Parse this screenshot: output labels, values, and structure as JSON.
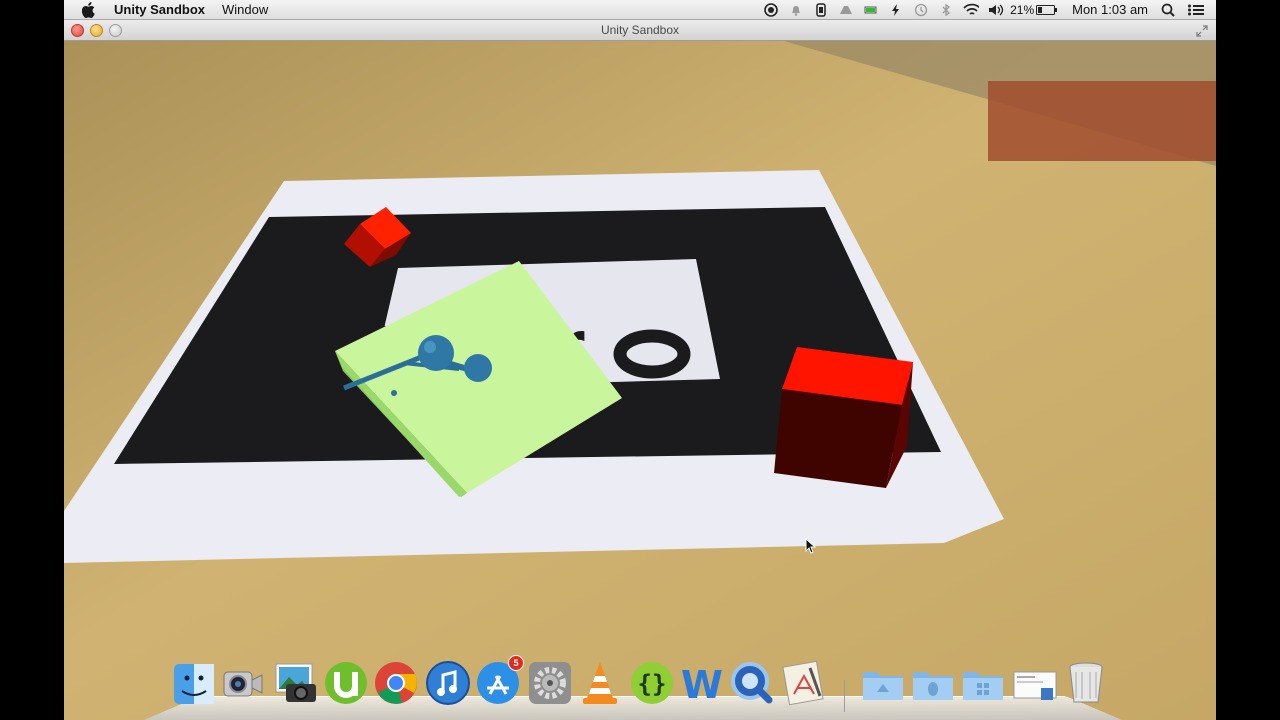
{
  "menubar": {
    "apple_icon": "apple-icon",
    "app_name": "Unity Sandbox",
    "menus": [
      "Window"
    ],
    "status": {
      "battery_percent": "21%",
      "clock": "Mon 1:03 am",
      "icons": [
        "record-icon",
        "notification-bell-icon",
        "phone-icon",
        "drive-icon",
        "battery-green-icon",
        "power-icon",
        "time-machine-icon",
        "bluetooth-icon",
        "wifi-icon",
        "volume-icon",
        "battery-icon",
        "spotlight-icon",
        "notification-center-icon"
      ]
    }
  },
  "window": {
    "title": "Unity Sandbox"
  },
  "dock": {
    "items": [
      {
        "name": "finder",
        "icon": "finder-icon"
      },
      {
        "name": "facetime",
        "icon": "facetime-camera-icon"
      },
      {
        "name": "iphoto",
        "icon": "photo-camera-icon"
      },
      {
        "name": "utorrent",
        "icon": "utorrent-icon"
      },
      {
        "name": "chrome",
        "icon": "chrome-icon"
      },
      {
        "name": "itunes",
        "icon": "itunes-icon"
      },
      {
        "name": "app-store",
        "icon": "app-store-icon",
        "badge": "5"
      },
      {
        "name": "system-preferences",
        "icon": "gear-icon"
      },
      {
        "name": "vlc",
        "icon": "vlc-cone-icon"
      },
      {
        "name": "script-editor",
        "icon": "braces-icon"
      },
      {
        "name": "word",
        "icon": "word-w-icon"
      },
      {
        "name": "quicktime",
        "icon": "quicktime-icon"
      },
      {
        "name": "xcode",
        "icon": "xcode-icon"
      },
      {
        "name": "applications-folder",
        "icon": "folder-icon"
      },
      {
        "name": "linux-folder",
        "icon": "linux-folder-icon"
      },
      {
        "name": "windows-folder",
        "icon": "windows-folder-icon"
      },
      {
        "name": "downloads-stack",
        "icon": "document-stack-icon"
      },
      {
        "name": "trash",
        "icon": "trash-icon"
      }
    ]
  },
  "colors": {
    "table": "#c9a86a",
    "marker_black": "#1b1b1b",
    "paper": "#eeeef6",
    "red_cube": "#ff1a00",
    "green_cube": "#c8f59a",
    "blue_model": "#2a6e96"
  }
}
